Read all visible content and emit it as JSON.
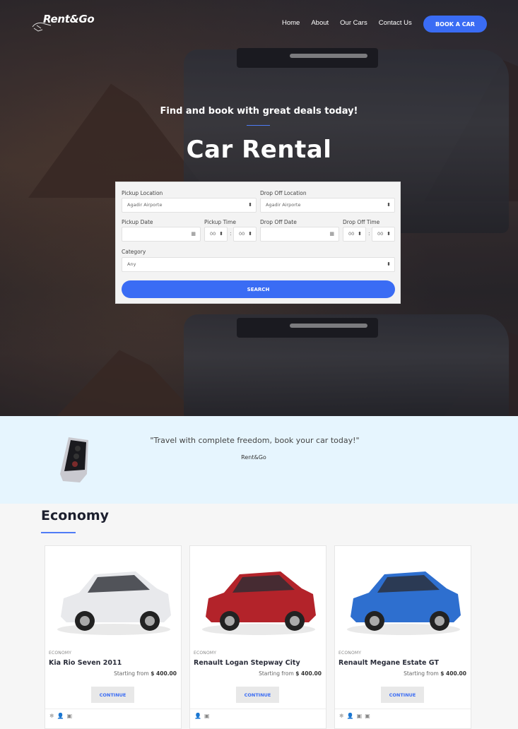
{
  "brand": {
    "name": "Rent&Go"
  },
  "nav": {
    "links": [
      "Home",
      "About",
      "Our Cars",
      "Contact Us"
    ],
    "cta": "BOOK A CAR"
  },
  "hero": {
    "tagline": "Find and book with great deals today!",
    "title": "Car Rental"
  },
  "search": {
    "pickup_location": {
      "label": "Pickup Location",
      "value": "Agadir Airporte"
    },
    "dropoff_location": {
      "label": "Drop Off Location",
      "value": "Agadir Airporte"
    },
    "pickup_date": {
      "label": "Pickup Date",
      "value": ""
    },
    "pickup_time": {
      "label": "Pickup Time",
      "hour": "00",
      "minute": "00"
    },
    "dropoff_date": {
      "label": "Drop Off Date",
      "value": ""
    },
    "dropoff_time": {
      "label": "Drop Off Time",
      "hour": "00",
      "minute": "00"
    },
    "category": {
      "label": "Category",
      "value": "Any"
    },
    "submit": "SEARCH"
  },
  "quote": {
    "text": "\"Travel with complete freedom, book your car today!\"",
    "author": "Rent&Go"
  },
  "economy": {
    "title": "Economy",
    "cards": [
      {
        "category": "ECONOMY",
        "name": "Kia Rio Seven 2011",
        "price_prefix": "Starting from",
        "price": "$ 400.00",
        "cta": "CONTINUE",
        "color": "#e8e9ec",
        "features": [
          "snowflake-icon",
          "person-icon",
          "luggage-icon"
        ]
      },
      {
        "category": "ECONOMY",
        "name": "Renault Logan Stepway City",
        "price_prefix": "Starting from",
        "price": "$ 400.00",
        "cta": "CONTINUE",
        "color": "#b3232a",
        "features": [
          "person-icon",
          "luggage-icon"
        ]
      },
      {
        "category": "ECONOMY",
        "name": "Renault Megane Estate GT",
        "price_prefix": "Starting from",
        "price": "$ 400.00",
        "cta": "CONTINUE",
        "color": "#2e6fcf",
        "features": [
          "snowflake-icon",
          "person-icon",
          "luggage-icon",
          "luggage-icon"
        ]
      }
    ]
  },
  "colors": {
    "accent": "#3a6cf4",
    "band": "#e6f5fe"
  }
}
